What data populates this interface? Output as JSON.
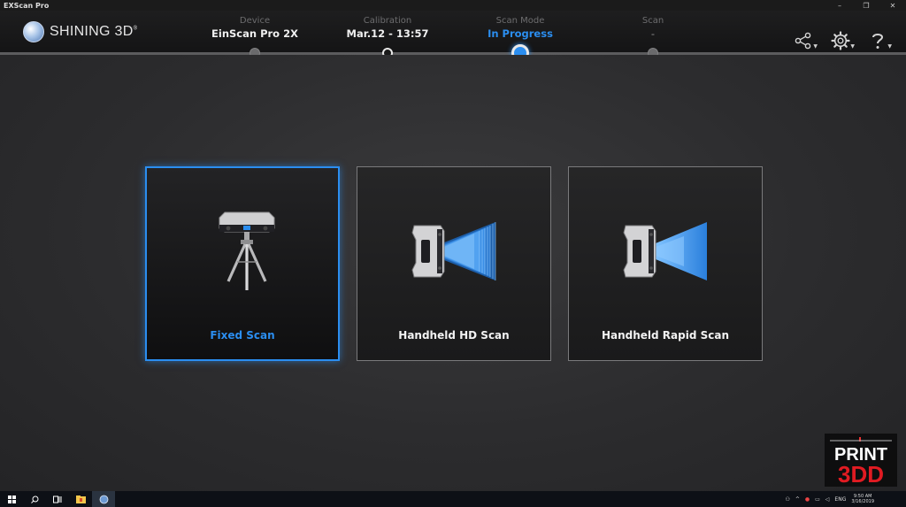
{
  "window": {
    "title": "EXScan Pro",
    "controls": [
      "–",
      "❐",
      "✕"
    ]
  },
  "header": {
    "logo_text": "SHINING 3D",
    "logo_mark": "®",
    "steps": [
      {
        "label": "Device",
        "value": "EinScan Pro 2X",
        "state": "done"
      },
      {
        "label": "Calibration",
        "value": "Mar.12 - 13:57",
        "state": "done"
      },
      {
        "label": "Scan Mode",
        "value": "In Progress",
        "state": "active"
      },
      {
        "label": "Scan",
        "value": "-",
        "state": "pending"
      }
    ],
    "icons": [
      "share-icon",
      "settings-icon",
      "help-icon"
    ]
  },
  "scan_modes": [
    {
      "label": "Fixed Scan",
      "selected": true,
      "icon": "tripod-scanner-icon"
    },
    {
      "label": "Handheld HD Scan",
      "selected": false,
      "icon": "handheld-hd-scanner-icon"
    },
    {
      "label": "Handheld Rapid Scan",
      "selected": false,
      "icon": "handheld-rapid-scanner-icon"
    }
  ],
  "watermark": {
    "line1": "PRINT",
    "line2": "3DD"
  },
  "taskbar": {
    "items": [
      "windows-start-icon",
      "search-icon",
      "task-view-icon",
      "file-explorer-icon",
      "exscan-app-icon"
    ],
    "tray_language": "ENG",
    "clock_time": "9:50 AM",
    "clock_date": "3/16/2019"
  },
  "colors": {
    "accent": "#2b8ef0",
    "background": "#2a2a2c",
    "header": "#1a1a1b"
  }
}
